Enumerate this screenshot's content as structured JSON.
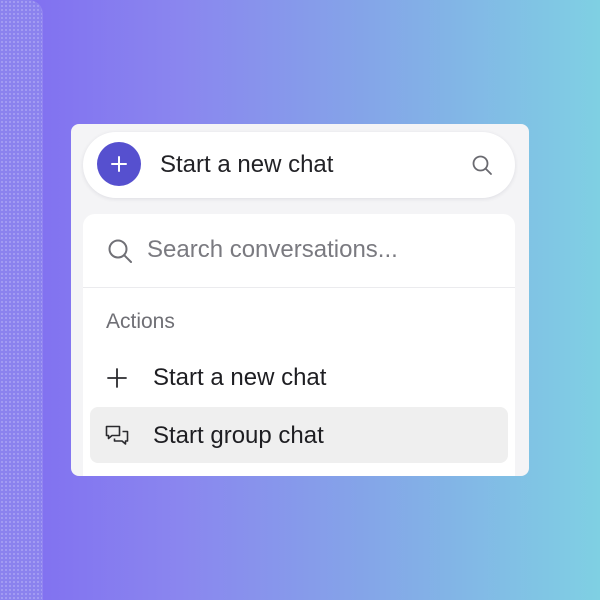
{
  "background": {
    "gradient_colors": [
      "#7f6cf0",
      "#8a86ef",
      "#84a6e8",
      "#7fd0e3"
    ]
  },
  "composer": {
    "label": "Start a new chat",
    "plus_icon": "plus-icon",
    "search_icon": "search-icon",
    "accent_color": "#5650cf"
  },
  "search": {
    "placeholder": "Search conversations...",
    "value": "",
    "icon": "search-icon"
  },
  "actions": {
    "section_label": "Actions",
    "items": [
      {
        "label": "Start a new chat",
        "icon": "plus-icon",
        "highlighted": false
      },
      {
        "label": "Start group chat",
        "icon": "chat-bubbles-icon",
        "highlighted": true
      }
    ]
  }
}
